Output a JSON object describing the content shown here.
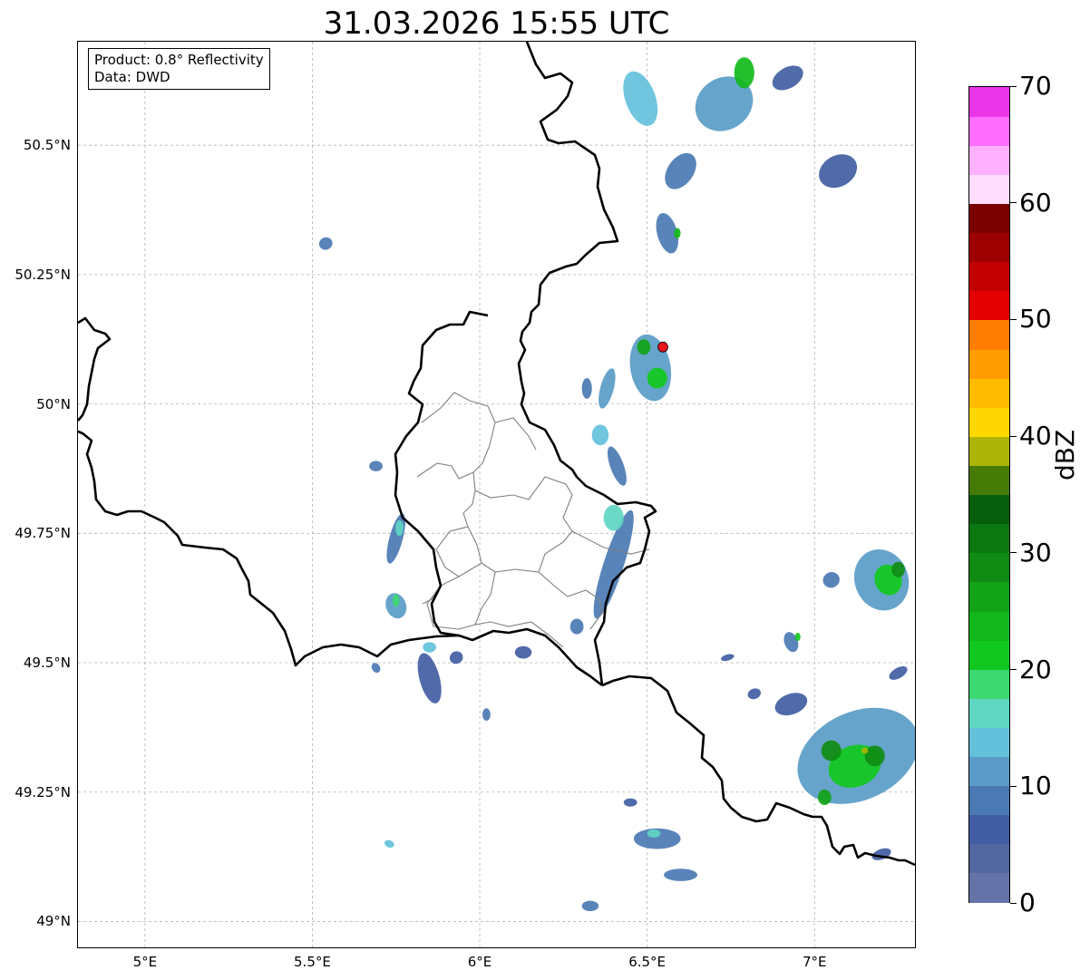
{
  "title": "31.03.2026 15:55 UTC",
  "info": {
    "product": "Product: 0.8° Reflectivity",
    "data": "Data: DWD"
  },
  "axes": {
    "lon_range": [
      4.8,
      7.3
    ],
    "lat_range": [
      48.95,
      50.7
    ],
    "lon_ticks": [
      {
        "value": 5.0,
        "label": "5°E"
      },
      {
        "value": 5.5,
        "label": "5.5°E"
      },
      {
        "value": 6.0,
        "label": "6°E"
      },
      {
        "value": 6.5,
        "label": "6.5°E"
      },
      {
        "value": 7.0,
        "label": "7°E"
      }
    ],
    "lat_ticks": [
      {
        "value": 50.5,
        "label": "50.5°N"
      },
      {
        "value": 50.25,
        "label": "50.25°N"
      },
      {
        "value": 50.0,
        "label": "50°N"
      },
      {
        "value": 49.75,
        "label": "49.75°N"
      },
      {
        "value": 49.5,
        "label": "49.5°N"
      },
      {
        "value": 49.25,
        "label": "49.25°N"
      },
      {
        "value": 49.0,
        "label": "49°N"
      }
    ],
    "grid": true
  },
  "colorbar": {
    "label": "dBZ",
    "min": 0,
    "max": 70,
    "tick_labels": [
      {
        "value": 0,
        "label": "0"
      },
      {
        "value": 10,
        "label": "10"
      },
      {
        "value": 20,
        "label": "20"
      },
      {
        "value": 30,
        "label": "30"
      },
      {
        "value": 40,
        "label": "40"
      },
      {
        "value": 50,
        "label": "50"
      },
      {
        "value": 60,
        "label": "60"
      },
      {
        "value": 70,
        "label": "70"
      }
    ],
    "colors": [
      "#6473a8",
      "#52679f",
      "#415da3",
      "#4a79b3",
      "#5a9cc7",
      "#64c1dc",
      "#5fd6c2",
      "#3dd871",
      "#11c91e",
      "#12b81b",
      "#12a317",
      "#108c14",
      "#0b7711",
      "#075f0d",
      "#467b08",
      "#acb407",
      "#fed700",
      "#ffbb00",
      "#ff9c00",
      "#ff7d00",
      "#e30000",
      "#c30000",
      "#9e0000",
      "#7a0000",
      "#ffddff",
      "#ffb1ff",
      "#ff6eff",
      "#e836e8"
    ]
  },
  "radar_site": {
    "lon": 6.547,
    "lat": 50.11,
    "color": "#e8131b"
  },
  "colors": {
    "border": "#000000",
    "admin": "#808080",
    "grid": "#b4b4b4"
  },
  "echoes": [
    {
      "lon": 6.48,
      "lat": 50.59,
      "rx": 0.045,
      "ry": 0.055,
      "angle": -20,
      "level": 5
    },
    {
      "lon": 6.73,
      "lat": 50.58,
      "rx": 0.09,
      "ry": 0.05,
      "angle": -35,
      "level": 4
    },
    {
      "lon": 6.79,
      "lat": 50.64,
      "rx": 0.03,
      "ry": 0.03,
      "angle": 0,
      "level": 9
    },
    {
      "lon": 6.6,
      "lat": 50.45,
      "rx": 0.06,
      "ry": 0.025,
      "angle": -55,
      "level": 3
    },
    {
      "lon": 6.92,
      "lat": 50.63,
      "rx": 0.05,
      "ry": 0.02,
      "angle": -30,
      "level": 2
    },
    {
      "lon": 7.07,
      "lat": 50.45,
      "rx": 0.06,
      "ry": 0.03,
      "angle": -30,
      "level": 2
    },
    {
      "lon": 6.56,
      "lat": 50.33,
      "rx": 0.03,
      "ry": 0.04,
      "angle": -15,
      "level": 3
    },
    {
      "lon": 6.59,
      "lat": 50.33,
      "rx": 0.01,
      "ry": 0.01,
      "angle": 0,
      "level": 9
    },
    {
      "lon": 5.54,
      "lat": 50.31,
      "rx": 0.02,
      "ry": 0.012,
      "angle": -20,
      "level": 3
    },
    {
      "lon": 6.51,
      "lat": 50.07,
      "rx": 0.06,
      "ry": 0.065,
      "angle": -10,
      "level": 4
    },
    {
      "lon": 6.49,
      "lat": 50.11,
      "rx": 0.02,
      "ry": 0.015,
      "angle": 0,
      "level": 10
    },
    {
      "lon": 6.38,
      "lat": 50.03,
      "rx": 0.02,
      "ry": 0.04,
      "angle": 15,
      "level": 4
    },
    {
      "lon": 6.36,
      "lat": 49.94,
      "rx": 0.025,
      "ry": 0.02,
      "angle": 0,
      "level": 5
    },
    {
      "lon": 6.41,
      "lat": 49.88,
      "rx": 0.02,
      "ry": 0.04,
      "angle": -20,
      "level": 3
    },
    {
      "lon": 6.53,
      "lat": 50.05,
      "rx": 0.03,
      "ry": 0.02,
      "angle": 0,
      "level": 8
    },
    {
      "lon": 6.32,
      "lat": 50.03,
      "rx": 0.015,
      "ry": 0.02,
      "angle": 0,
      "level": 3
    },
    {
      "lon": 6.4,
      "lat": 49.69,
      "rx": 0.03,
      "ry": 0.11,
      "angle": 18,
      "level": 3
    },
    {
      "lon": 6.4,
      "lat": 49.78,
      "rx": 0.03,
      "ry": 0.025,
      "angle": 0,
      "level": 6
    },
    {
      "lon": 6.29,
      "lat": 49.57,
      "rx": 0.02,
      "ry": 0.015,
      "angle": 0,
      "level": 3
    },
    {
      "lon": 5.75,
      "lat": 49.74,
      "rx": 0.02,
      "ry": 0.05,
      "angle": 15,
      "level": 3
    },
    {
      "lon": 5.76,
      "lat": 49.76,
      "rx": 0.012,
      "ry": 0.015,
      "angle": 0,
      "level": 6
    },
    {
      "lon": 5.75,
      "lat": 49.61,
      "rx": 0.03,
      "ry": 0.025,
      "angle": -20,
      "level": 4
    },
    {
      "lon": 5.75,
      "lat": 49.62,
      "rx": 0.01,
      "ry": 0.012,
      "angle": 0,
      "level": 7
    },
    {
      "lon": 5.85,
      "lat": 49.47,
      "rx": 0.03,
      "ry": 0.05,
      "angle": -15,
      "level": 2
    },
    {
      "lon": 5.85,
      "lat": 49.53,
      "rx": 0.02,
      "ry": 0.01,
      "angle": 0,
      "level": 5
    },
    {
      "lon": 5.69,
      "lat": 49.88,
      "rx": 0.02,
      "ry": 0.01,
      "angle": 0,
      "level": 3
    },
    {
      "lon": 5.69,
      "lat": 49.49,
      "rx": 0.012,
      "ry": 0.01,
      "angle": -30,
      "level": 3
    },
    {
      "lon": 5.73,
      "lat": 49.15,
      "rx": 0.015,
      "ry": 0.007,
      "angle": 20,
      "level": 5
    },
    {
      "lon": 6.02,
      "lat": 49.4,
      "rx": 0.012,
      "ry": 0.012,
      "angle": 0,
      "level": 3
    },
    {
      "lon": 6.13,
      "lat": 49.52,
      "rx": 0.025,
      "ry": 0.012,
      "angle": 0,
      "level": 2
    },
    {
      "lon": 5.93,
      "lat": 49.51,
      "rx": 0.02,
      "ry": 0.012,
      "angle": -30,
      "level": 2
    },
    {
      "lon": 6.45,
      "lat": 49.23,
      "rx": 0.02,
      "ry": 0.008,
      "angle": 0,
      "level": 2
    },
    {
      "lon": 6.53,
      "lat": 49.16,
      "rx": 0.07,
      "ry": 0.02,
      "angle": 0,
      "level": 3
    },
    {
      "lon": 6.52,
      "lat": 49.17,
      "rx": 0.02,
      "ry": 0.008,
      "angle": 0,
      "level": 6
    },
    {
      "lon": 6.6,
      "lat": 49.09,
      "rx": 0.05,
      "ry": 0.012,
      "angle": 0,
      "level": 3
    },
    {
      "lon": 6.33,
      "lat": 49.03,
      "rx": 0.025,
      "ry": 0.01,
      "angle": 0,
      "level": 3
    },
    {
      "lon": 7.13,
      "lat": 49.32,
      "rx": 0.19,
      "ry": 0.085,
      "angle": -25,
      "level": 4
    },
    {
      "lon": 7.12,
      "lat": 49.3,
      "rx": 0.08,
      "ry": 0.04,
      "angle": -20,
      "level": 8
    },
    {
      "lon": 7.05,
      "lat": 49.33,
      "rx": 0.03,
      "ry": 0.02,
      "angle": 0,
      "level": 11
    },
    {
      "lon": 7.18,
      "lat": 49.32,
      "rx": 0.03,
      "ry": 0.02,
      "angle": 0,
      "level": 11
    },
    {
      "lon": 7.03,
      "lat": 49.24,
      "rx": 0.02,
      "ry": 0.015,
      "angle": 0,
      "level": 10
    },
    {
      "lon": 7.15,
      "lat": 49.33,
      "rx": 0.01,
      "ry": 0.006,
      "angle": 0,
      "level": 15
    },
    {
      "lon": 6.93,
      "lat": 49.42,
      "rx": 0.05,
      "ry": 0.02,
      "angle": -20,
      "level": 2
    },
    {
      "lon": 7.2,
      "lat": 49.66,
      "rx": 0.08,
      "ry": 0.06,
      "angle": -20,
      "level": 4
    },
    {
      "lon": 7.22,
      "lat": 49.66,
      "rx": 0.04,
      "ry": 0.03,
      "angle": -20,
      "level": 8
    },
    {
      "lon": 7.25,
      "lat": 49.68,
      "rx": 0.02,
      "ry": 0.015,
      "angle": 0,
      "level": 11
    },
    {
      "lon": 7.05,
      "lat": 49.66,
      "rx": 0.025,
      "ry": 0.015,
      "angle": -20,
      "level": 3
    },
    {
      "lon": 6.93,
      "lat": 49.54,
      "rx": 0.02,
      "ry": 0.02,
      "angle": -20,
      "level": 3
    },
    {
      "lon": 6.95,
      "lat": 49.55,
      "rx": 0.008,
      "ry": 0.008,
      "angle": 0,
      "level": 8
    },
    {
      "lon": 6.82,
      "lat": 49.44,
      "rx": 0.02,
      "ry": 0.01,
      "angle": -20,
      "level": 2
    },
    {
      "lon": 7.2,
      "lat": 49.13,
      "rx": 0.03,
      "ry": 0.01,
      "angle": -20,
      "level": 2
    },
    {
      "lon": 7.25,
      "lat": 49.48,
      "rx": 0.03,
      "ry": 0.01,
      "angle": -30,
      "level": 2
    },
    {
      "lon": 6.74,
      "lat": 49.51,
      "rx": 0.02,
      "ry": 0.006,
      "angle": -15,
      "level": 2
    }
  ]
}
